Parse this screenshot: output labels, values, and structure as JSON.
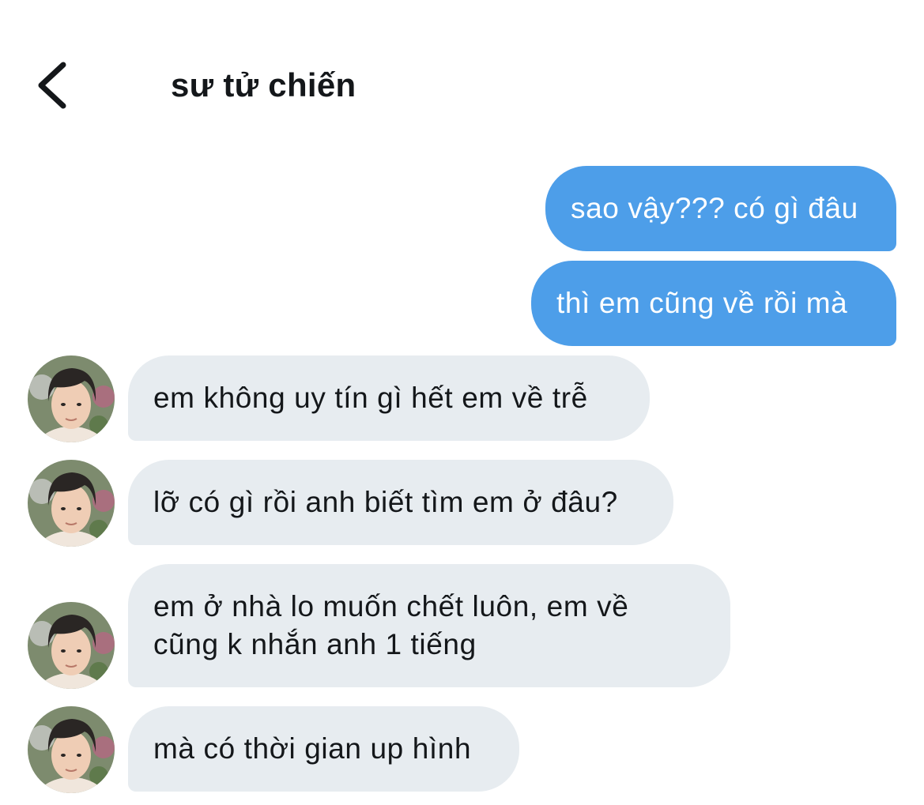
{
  "header": {
    "back_icon": "chevron-left-icon",
    "title": "sư tử chiến"
  },
  "colors": {
    "sent_bubble": "#4d9ee9",
    "received_bubble": "#e7ecf0",
    "background": "#ffffff",
    "text": "#14171a"
  },
  "messages": [
    {
      "direction": "sent",
      "text": "sao vậy??? có gì đâu"
    },
    {
      "direction": "sent",
      "text": "thì em cũng về rồi mà"
    },
    {
      "direction": "received",
      "text": "em không uy tín gì hết em về trễ"
    },
    {
      "direction": "received",
      "text": "lỡ có gì rồi anh biết tìm em ở đâu?"
    },
    {
      "direction": "received",
      "lines": [
        "em ở nhà lo muốn chết luôn, em về",
        "cũng k nhắn anh 1 tiếng"
      ]
    },
    {
      "direction": "received",
      "text": "mà có thời gian up hình"
    }
  ],
  "avatar_icon": "user-avatar-photo"
}
